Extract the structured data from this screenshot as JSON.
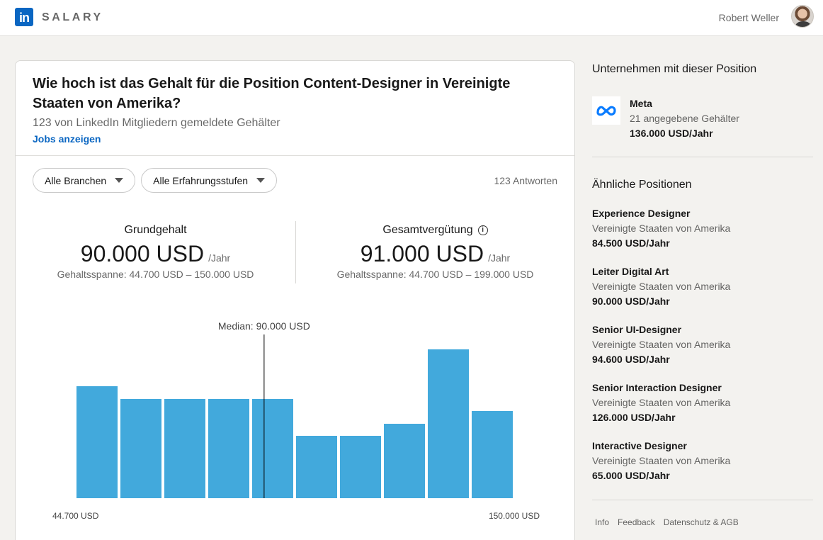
{
  "header": {
    "logo_text": "in",
    "brand": "SALARY",
    "user_name": "Robert Weller"
  },
  "card": {
    "title": "Wie hoch ist das Gehalt für die Position Content-Designer in Vereinigte Staaten von Amerika?",
    "subtitle": "123 von LinkedIn Mitgliedern gemeldete Gehälter",
    "jobs_link": "Jobs anzeigen",
    "filters": {
      "industry": "Alle Branchen",
      "experience": "Alle Erfahrungsstufen"
    },
    "responses": "123 Antworten",
    "base": {
      "label": "Grundgehalt",
      "value": "90.000 USD",
      "unit": "/Jahr",
      "range": "Gehaltsspanne: 44.700 USD – 150.000 USD"
    },
    "total": {
      "label": "Gesamtvergütung",
      "value": "91.000 USD",
      "unit": "/Jahr",
      "range": "Gehaltsspanne: 44.700 USD – 199.000 USD"
    }
  },
  "chart_data": {
    "type": "bar",
    "bar_color": "#42a9dc",
    "categories": [
      "1",
      "2",
      "3",
      "4",
      "5",
      "6",
      "7",
      "8",
      "9",
      "10"
    ],
    "values": [
      158,
      140,
      140,
      140,
      140,
      88,
      88,
      105,
      210,
      123
    ],
    "x_min_label": "44.700 USD",
    "x_max_label": "150.000 USD",
    "median_label": "Median: 90.000 USD",
    "median_position": 0.43
  },
  "sidebar": {
    "companies_heading": "Unternehmen mit dieser Position",
    "company": {
      "name": "Meta",
      "count": "21 angegebene Gehälter",
      "pay": "136.000 USD/Jahr"
    },
    "similar_heading": "Ähnliche Positionen",
    "similar": [
      {
        "title": "Experience Designer",
        "location": "Vereinigte Staaten von Amerika",
        "pay": "84.500 USD/Jahr"
      },
      {
        "title": "Leiter Digital Art",
        "location": "Vereinigte Staaten von Amerika",
        "pay": "90.000 USD/Jahr"
      },
      {
        "title": "Senior UI-Designer",
        "location": "Vereinigte Staaten von Amerika",
        "pay": "94.600 USD/Jahr"
      },
      {
        "title": "Senior Interaction Designer",
        "location": "Vereinigte Staaten von Amerika",
        "pay": "126.000 USD/Jahr"
      },
      {
        "title": "Interactive Designer",
        "location": "Vereinigte Staaten von Amerika",
        "pay": "65.000 USD/Jahr"
      }
    ],
    "footer": [
      "Info",
      "Feedback",
      "Datenschutz & AGB"
    ]
  }
}
